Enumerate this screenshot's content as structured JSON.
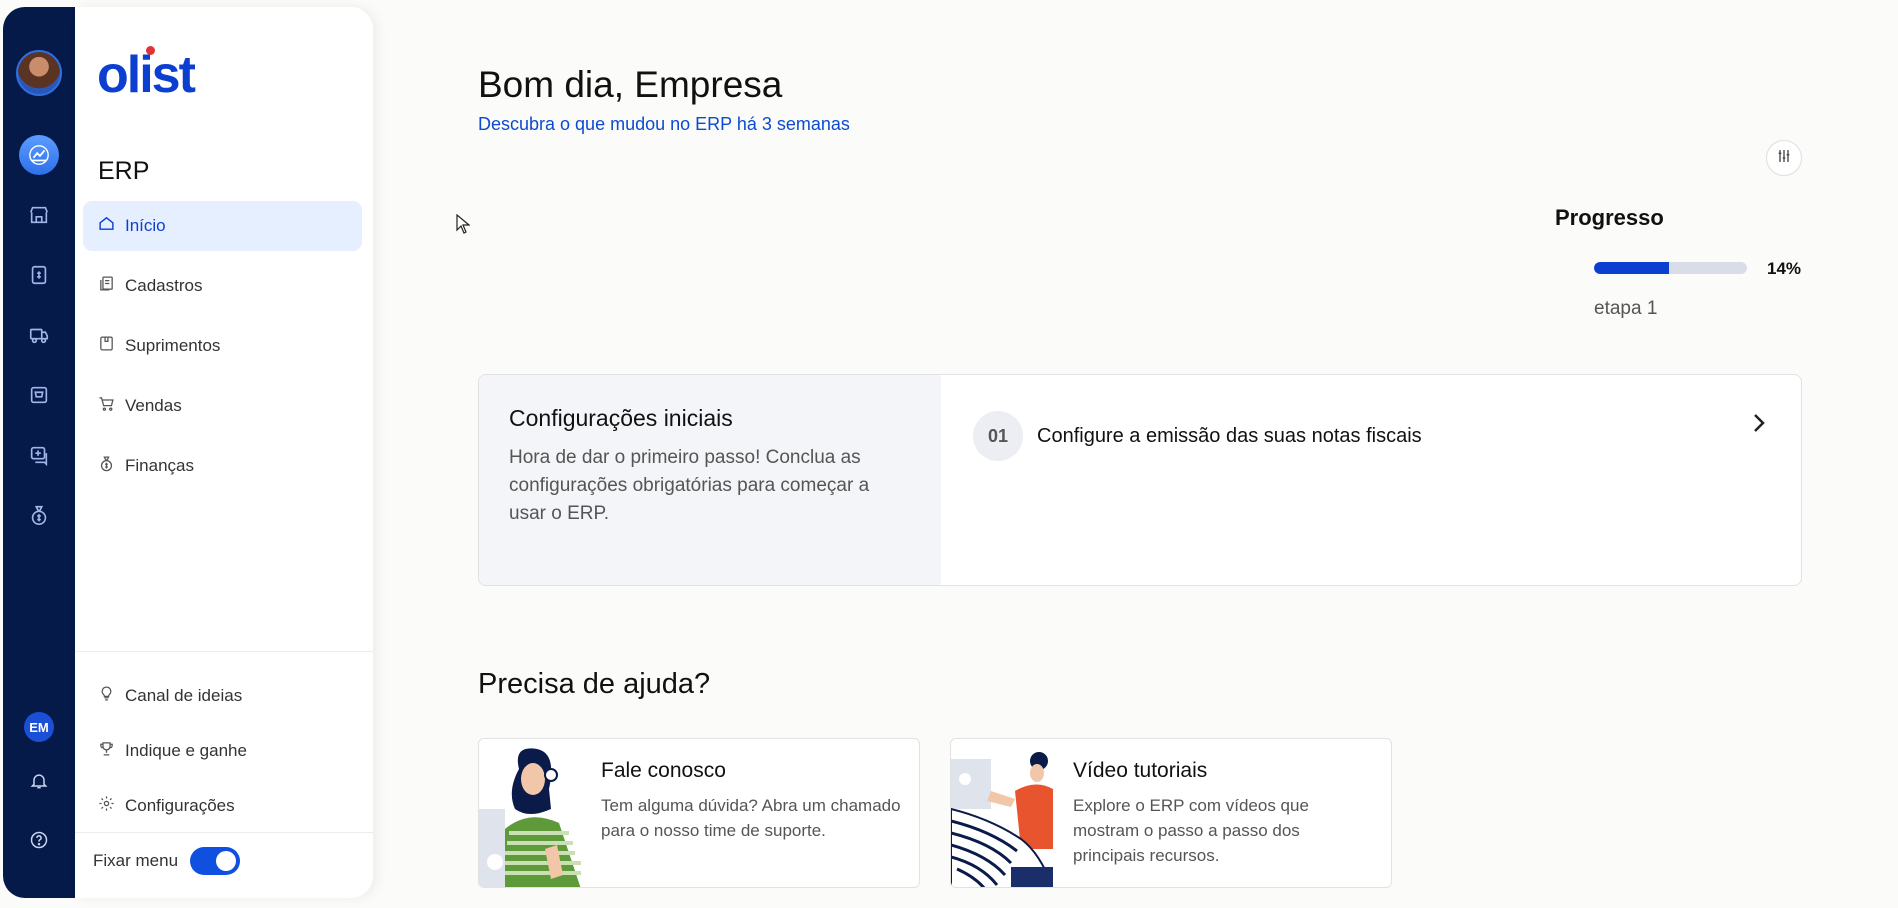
{
  "rail": {
    "icons": [
      "dashboard-icon",
      "store-icon",
      "receipt-icon",
      "delivery-icon",
      "cart-icon",
      "support-icon",
      "money-bag-icon"
    ],
    "user_initials": "EM"
  },
  "sidebar": {
    "logo": "olist",
    "app_title": "ERP",
    "items": [
      {
        "label": "Início",
        "icon": "home-icon"
      },
      {
        "label": "Cadastros",
        "icon": "files-icon"
      },
      {
        "label": "Suprimentos",
        "icon": "box-icon"
      },
      {
        "label": "Vendas",
        "icon": "cart-icon"
      },
      {
        "label": "Finanças",
        "icon": "money-bag-icon"
      }
    ],
    "bottom_items": [
      {
        "label": "Canal de ideias",
        "icon": "lightbulb-icon"
      },
      {
        "label": "Indique e ganhe",
        "icon": "trophy-icon"
      },
      {
        "label": "Configurações",
        "icon": "gear-icon"
      }
    ],
    "pin_label": "Fixar menu",
    "pin_enabled": true
  },
  "main": {
    "greeting": "Bom dia, Empresa",
    "whats_new": "Descubra o que mudou no ERP há 3 semanas",
    "progress": {
      "title": "Progresso",
      "percent": 14,
      "percent_label": "14%",
      "step": "etapa 1"
    },
    "setup": {
      "title": "Configurações iniciais",
      "description": "Hora de dar o primeiro passo! Conclua as configurações obrigatórias para começar a usar o ERP.",
      "step_number": "01",
      "step_text": "Configure a emissão das suas notas fiscais"
    },
    "help": {
      "title": "Precisa de ajuda?",
      "cards": [
        {
          "title": "Fale conosco",
          "text": "Tem alguma dúvida? Abra um chamado para o nosso time de suporte."
        },
        {
          "title": "Vídeo tutoriais",
          "text": "Explore o ERP com vídeos que mostram o passo a passo dos principais recursos."
        }
      ]
    }
  },
  "colors": {
    "rail_bg": "#061a4a",
    "accent": "#0c3fd0",
    "active_bg": "#e6efff",
    "logo_dot": "#e03333"
  }
}
